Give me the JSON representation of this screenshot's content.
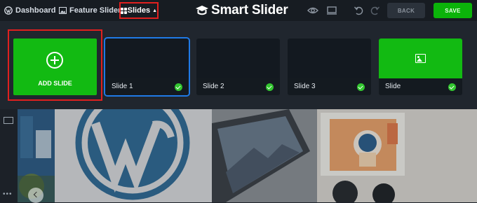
{
  "breadcrumb": {
    "items": [
      {
        "label": "Dashboard",
        "icon": "wordpress-icon"
      },
      {
        "label": "Feature Slider",
        "icon": "image-icon"
      },
      {
        "label": "Slides",
        "icon": "grid-icon",
        "caret": "▲"
      }
    ]
  },
  "app": {
    "logo_text": "Smart Slider",
    "logo_icon": "graduation-cap-icon"
  },
  "toolbar": {
    "icons": [
      "preview-eye-icon",
      "desktop-view-icon",
      "undo-icon",
      "redo-icon"
    ],
    "back_label": "BACK",
    "save_label": "SAVE"
  },
  "slides": {
    "add_label": "ADD SLIDE",
    "items": [
      {
        "label": "Slide 1",
        "selected": true,
        "published": true
      },
      {
        "label": "Slide 2",
        "selected": false,
        "published": true
      },
      {
        "label": "Slide 3",
        "selected": false,
        "published": true
      },
      {
        "label": "Slide",
        "selected": false,
        "published": true,
        "thumbnail": "image-icon"
      }
    ]
  },
  "colors": {
    "accent_green": "#12ba12",
    "selection_blue": "#1f7ae6",
    "highlight_red": "#e0201f"
  }
}
